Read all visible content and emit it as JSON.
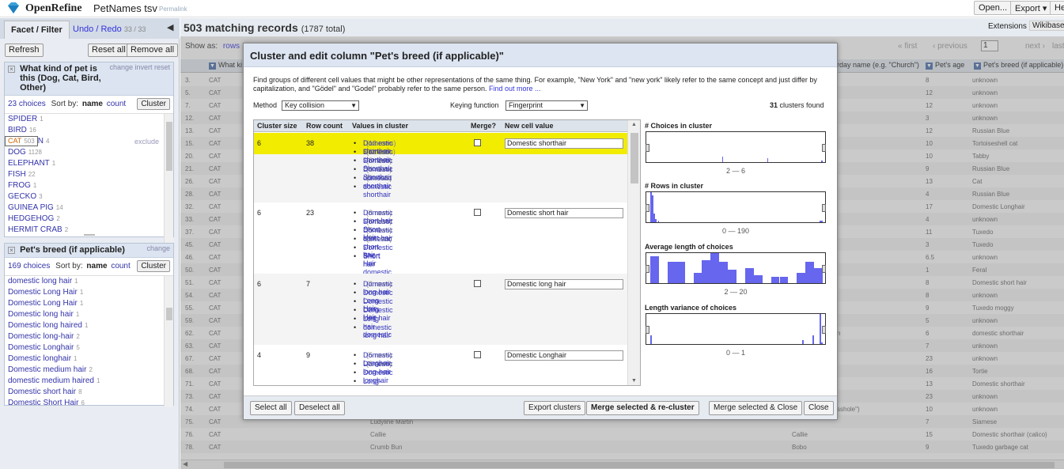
{
  "header": {
    "app_name": "OpenRefine",
    "project_name": "PetNames tsv",
    "permalink": "Permalink",
    "buttons": [
      "Open...",
      "Export ▾",
      "He"
    ]
  },
  "left_panel": {
    "tabs": {
      "facet": "Facet / Filter",
      "undo": "Undo / Redo",
      "undo_count": "33 / 33"
    },
    "refresh": "Refresh",
    "reset_all": "Reset all",
    "remove_all": "Remove all",
    "facet1": {
      "title": "What kind of pet is this (Dog, Cat, Bird, Other)",
      "controls": "change invert reset",
      "choices": "23 choices",
      "sort_by": "Sort by:",
      "sort_name": "name",
      "sort_count": "count",
      "cluster": "Cluster",
      "exclude": "exclude",
      "items": [
        {
          "label": "SPIDER",
          "count": "1"
        },
        {
          "label": "BIRD",
          "count": "16"
        },
        {
          "label": "CAT",
          "count": "503"
        },
        {
          "label": "CHICKEN",
          "count": "4"
        },
        {
          "label": "DOG",
          "count": "1128"
        },
        {
          "label": "ELEPHANT",
          "count": "1"
        },
        {
          "label": "FISH",
          "count": "22"
        },
        {
          "label": "FROG",
          "count": "1"
        },
        {
          "label": "GECKO",
          "count": "3"
        },
        {
          "label": "GUINEA PIG",
          "count": "14"
        },
        {
          "label": "HEDGEHOG",
          "count": "2"
        },
        {
          "label": "HERMIT CRAB",
          "count": "2"
        }
      ]
    },
    "facet2": {
      "title": "Pet's breed (if applicable)",
      "controls": "change",
      "choices": "169 choices",
      "sort_by": "Sort by:",
      "sort_name": "name",
      "sort_count": "count",
      "cluster": "Cluster",
      "items": [
        {
          "label": "domestic long hair",
          "count": "1"
        },
        {
          "label": "Domestic Long Hair",
          "count": "1"
        },
        {
          "label": "Domestic Long Hair",
          "count": "1"
        },
        {
          "label": "Domestic long hair",
          "count": "1"
        },
        {
          "label": "Domestic long haired",
          "count": "1"
        },
        {
          "label": "Domestic long-hair",
          "count": "2"
        },
        {
          "label": "Domestic Longhair",
          "count": "5"
        },
        {
          "label": "Domestic longhair",
          "count": "1"
        },
        {
          "label": "Domestic medium hair",
          "count": "2"
        },
        {
          "label": "domestic medium haired",
          "count": "1"
        },
        {
          "label": "Domestic short hair",
          "count": "8"
        },
        {
          "label": "Domestic Short Hair",
          "count": "6"
        }
      ]
    }
  },
  "main": {
    "title": "503 matching records",
    "total": "(1787 total)",
    "extensions": "Extensions",
    "wikibase": "Wikibase",
    "show_as": "Show as:",
    "show_rows": "rows",
    "first": "« first",
    "previous": "‹ previous",
    "page": "1",
    "next": "next ›",
    "last": "last",
    "col_what": "What ki",
    "col_day": "rday name (e.g. \"Church\")",
    "col_age": "Pet's age",
    "col_breed": "Pet's breed (if applicable)",
    "rows": [
      {
        "n": "3.",
        "t": "CAT",
        "a": "",
        "b": "",
        "d": "",
        "age": "8",
        "br": "unknown"
      },
      {
        "n": "5.",
        "t": "CAT",
        "a": "",
        "b": "",
        "d": "",
        "age": "12",
        "br": "unknown"
      },
      {
        "n": "7.",
        "t": "CAT",
        "a": "",
        "b": "",
        "d": "",
        "age": "12",
        "br": "unknown"
      },
      {
        "n": "12.",
        "t": "CAT",
        "a": "",
        "b": "",
        "d": "",
        "age": "3",
        "br": "unknown"
      },
      {
        "n": "13.",
        "t": "CAT",
        "a": "",
        "b": "",
        "d": "",
        "age": "12",
        "br": "Russian Blue"
      },
      {
        "n": "15.",
        "t": "CAT",
        "a": "",
        "b": "",
        "d": "",
        "age": "10",
        "br": "Tortoiseshell cat"
      },
      {
        "n": "20.",
        "t": "CAT",
        "a": "",
        "b": "",
        "d": "",
        "age": "10",
        "br": "Tabby"
      },
      {
        "n": "21.",
        "t": "CAT",
        "a": "",
        "b": "",
        "d": "",
        "age": "9",
        "br": "Russian Blue"
      },
      {
        "n": "26.",
        "t": "CAT",
        "a": "",
        "b": "",
        "d": "",
        "age": "13",
        "br": "Cat"
      },
      {
        "n": "28.",
        "t": "CAT",
        "a": "",
        "b": "",
        "d": "",
        "age": "4",
        "br": "Russian Blue"
      },
      {
        "n": "32.",
        "t": "CAT",
        "a": "",
        "b": "",
        "d": "",
        "age": "17",
        "br": "Domestic Longhair"
      },
      {
        "n": "33.",
        "t": "CAT",
        "a": "",
        "b": "",
        "d": "",
        "age": "4",
        "br": "unknown"
      },
      {
        "n": "37.",
        "t": "CAT",
        "a": "",
        "b": "",
        "d": "",
        "age": "11",
        "br": "Tuxedo"
      },
      {
        "n": "45.",
        "t": "CAT",
        "a": "",
        "b": "",
        "d": "",
        "age": "3",
        "br": "Tuxedo"
      },
      {
        "n": "46.",
        "t": "CAT",
        "a": "",
        "b": "",
        "d": "",
        "age": "6.5",
        "br": "unknown"
      },
      {
        "n": "50.",
        "t": "CAT",
        "a": "",
        "b": "",
        "d": "",
        "age": "1",
        "br": "Feral"
      },
      {
        "n": "51.",
        "t": "CAT",
        "a": "",
        "b": "",
        "d": "",
        "age": "8",
        "br": "Domestic short hair"
      },
      {
        "n": "54.",
        "t": "CAT",
        "a": "",
        "b": "",
        "d": "",
        "age": "8",
        "br": "unknown"
      },
      {
        "n": "55.",
        "t": "CAT",
        "a": "",
        "b": "",
        "d": "",
        "age": "9",
        "br": "Tuxedo moggy"
      },
      {
        "n": "59.",
        "t": "CAT",
        "a": "",
        "b": "",
        "d": "",
        "age": "5",
        "br": "unknown"
      },
      {
        "n": "62.",
        "t": "CAT",
        "a": "",
        "b": "",
        "d": "n",
        "age": "6",
        "br": "domestic shorthair"
      },
      {
        "n": "63.",
        "t": "CAT",
        "a": "",
        "b": "",
        "d": "",
        "age": "7",
        "br": "unknown"
      },
      {
        "n": "67.",
        "t": "CAT",
        "a": "",
        "b": "",
        "d": "",
        "age": "23",
        "br": "unknown"
      },
      {
        "n": "68.",
        "t": "CAT",
        "a": "",
        "b": "",
        "d": "",
        "age": "16",
        "br": "Tortie"
      },
      {
        "n": "71.",
        "t": "CAT",
        "a": "",
        "b": "",
        "d": "",
        "age": "13",
        "br": "Domestic shorthair"
      },
      {
        "n": "73.",
        "t": "CAT",
        "a": "",
        "b": "",
        "d": "",
        "age": "23",
        "br": "unknown"
      },
      {
        "n": "74.",
        "t": "CAT",
        "a": "",
        "b": "",
        "d": "sshole\")",
        "age": "10",
        "br": "unknown"
      },
      {
        "n": "75.",
        "t": "CAT",
        "a": "Ludyline Martin",
        "b": "",
        "d": "",
        "age": "7",
        "br": "Siamese"
      },
      {
        "n": "76.",
        "t": "CAT",
        "a": "Callie",
        "b": "Callie",
        "d": "",
        "age": "15",
        "br": "Domestic shorthair (calico)"
      },
      {
        "n": "78.",
        "t": "CAT",
        "a": "Crumb Bun",
        "b": "Bobo",
        "d": "",
        "age": "9",
        "br": "Tuxedo garbage cat"
      }
    ]
  },
  "dialog": {
    "title": "Cluster and edit column \"Pet's breed (if applicable)\"",
    "description": "Find groups of different cell values that might be other representations of the same thing. For example, \"New York\" and \"new york\" likely refer to the same concept and just differ by capitalization, and \"Gödel\" and \"Godel\" probably refer to the same person.",
    "find_out_more": "Find out more ...",
    "method_label": "Method",
    "method_value": "Key collision",
    "keying_label": "Keying function",
    "keying_value": "Fingerprint",
    "clusters_found_num": "31",
    "clusters_found_text": "clusters found",
    "headers": {
      "size": "Cluster size",
      "count": "Row count",
      "values": "Values in cluster",
      "merge": "Merge?",
      "new": "New cell value"
    },
    "clusters": [
      {
        "size": "6",
        "count": "38",
        "new_value": "Domestic shorthair",
        "highlight": true,
        "values": [
          {
            "v": "Domestic shorthair",
            "r": "(12 rows)"
          },
          {
            "v": "Domestic shorthair",
            "r": "(11 rows)"
          },
          {
            "v": "Domestic Shorthair",
            "r": "(8 rows)"
          },
          {
            "v": "Domestic Shorthair",
            "r": "(4 rows)"
          },
          {
            "v": "domestic shorthair",
            "r": "(2 rows)"
          },
          {
            "v": "domestic shorthair",
            "r": ""
          }
        ]
      },
      {
        "size": "6",
        "count": "23",
        "new_value": "Domestic short hair",
        "highlight": false,
        "values": [
          {
            "v": "Domestic short hair",
            "r": "(8 rows)"
          },
          {
            "v": "Domestic Short Hair",
            "r": "(6 rows)"
          },
          {
            "v": "Domestic short hair",
            "r": "(5 rows)"
          },
          {
            "v": "domestic short hair",
            "r": "(2 rows)"
          },
          {
            "v": "Domestic Short Hair",
            "r": ""
          },
          {
            "v": "Short hair domestic",
            "r": ""
          }
        ]
      },
      {
        "size": "6",
        "count": "7",
        "new_value": "Domestic long hair",
        "highlight": false,
        "values": [
          {
            "v": "Domestic long hair",
            "r": "(2 rows)"
          },
          {
            "v": "Domestic Long Hair",
            "r": ""
          },
          {
            "v": "Domestic Long Hair",
            "r": ""
          },
          {
            "v": "Domestic long hair",
            "r": ""
          },
          {
            "v": "Long hair domestic",
            "r": ""
          },
          {
            "v": "domestic long hair",
            "r": ""
          }
        ]
      },
      {
        "size": "4",
        "count": "9",
        "new_value": "Domestic Longhair",
        "highlight": false,
        "values": [
          {
            "v": "Domestic Longhair",
            "r": "(5 rows)"
          },
          {
            "v": "Domestic long-hair",
            "r": "(2 rows)"
          },
          {
            "v": "Domestic longhair",
            "r": ""
          },
          {
            "v": "Long-hair domestic",
            "r": ""
          }
        ]
      }
    ],
    "histograms": [
      {
        "title": "# Choices in cluster",
        "range": "2 — 6",
        "bars": [
          0,
          0,
          0,
          0,
          0,
          0,
          0,
          0,
          0,
          0,
          0,
          0,
          0,
          0,
          0,
          0,
          0,
          0,
          0,
          0,
          0,
          0,
          0,
          0,
          0,
          0,
          0,
          0,
          0,
          0,
          0,
          0,
          0,
          0,
          0,
          0,
          0,
          0,
          0,
          0,
          0,
          0,
          0,
          0,
          0,
          0,
          0,
          0,
          0,
          0,
          0,
          0,
          0,
          0,
          0.18,
          0,
          0,
          0,
          0,
          0,
          0,
          0,
          0,
          0,
          0,
          0,
          0,
          0,
          0,
          0,
          0,
          0,
          0,
          0,
          0,
          0,
          0,
          0,
          0,
          0,
          0,
          0,
          0,
          0,
          0,
          0,
          0,
          0,
          0.12,
          0,
          0,
          0,
          0,
          0,
          0,
          0,
          0,
          0,
          0,
          0,
          0,
          0,
          0,
          0,
          0,
          0,
          0,
          0,
          0,
          0,
          0,
          0,
          0,
          0,
          0,
          0,
          0,
          0,
          0,
          0,
          0,
          0,
          0,
          0,
          0,
          0,
          0,
          0,
          0,
          0.05
        ]
      },
      {
        "title": "# Rows in cluster",
        "range": "0 — 190",
        "bars": [
          1,
          0.9,
          0.3,
          0.1,
          0,
          0.05,
          0,
          0,
          0,
          0,
          0,
          0,
          0,
          0,
          0,
          0,
          0,
          0,
          0,
          0,
          0,
          0,
          0,
          0,
          0,
          0,
          0,
          0,
          0,
          0,
          0,
          0,
          0,
          0,
          0,
          0,
          0,
          0,
          0,
          0,
          0,
          0,
          0,
          0,
          0,
          0,
          0,
          0,
          0,
          0,
          0,
          0,
          0,
          0,
          0,
          0,
          0,
          0,
          0,
          0,
          0,
          0,
          0,
          0,
          0,
          0,
          0,
          0,
          0,
          0,
          0,
          0,
          0,
          0,
          0,
          0,
          0,
          0,
          0,
          0,
          0,
          0,
          0,
          0,
          0,
          0,
          0,
          0,
          0,
          0,
          0,
          0,
          0,
          0,
          0,
          0,
          0,
          0,
          0,
          0,
          0,
          0,
          0,
          0,
          0,
          0,
          0,
          0,
          0,
          0,
          0,
          0,
          0.05,
          0.05
        ]
      },
      {
        "title": "Average length of choices",
        "range": "2 — 20",
        "bars": [
          0.9,
          0,
          0.7,
          0.7,
          0,
          0.35,
          0.75,
          1,
          0.7,
          0.45,
          0,
          0.5,
          0.25,
          0,
          0.2,
          0.2,
          0,
          0.35,
          0.7,
          0.5
        ]
      },
      {
        "title": "Length variance of choices",
        "range": "0 — 1",
        "bars": [
          0.3,
          0,
          0,
          0,
          0,
          0,
          0,
          0,
          0,
          0,
          0,
          0,
          0,
          0,
          0,
          0,
          0,
          0,
          0,
          0,
          0,
          0,
          0,
          0,
          0,
          0,
          0,
          0,
          0,
          0,
          0,
          0,
          0,
          0,
          0,
          0,
          0,
          0,
          0,
          0,
          0,
          0,
          0,
          0,
          0,
          0,
          0,
          0,
          0,
          0,
          0,
          0,
          0,
          0,
          0,
          0,
          0,
          0,
          0,
          0,
          0,
          0,
          0,
          0,
          0,
          0,
          0,
          0,
          0,
          0,
          0,
          0,
          0,
          0,
          0,
          0,
          0,
          0,
          0,
          0,
          0,
          0,
          0,
          0,
          0,
          0,
          0,
          0,
          0,
          0,
          0.12,
          0,
          0,
          0,
          0,
          0,
          0.3,
          0,
          0,
          0,
          1,
          0.05
        ]
      }
    ],
    "buttons": {
      "select_all": "Select all",
      "deselect_all": "Deselect all",
      "export": "Export clusters",
      "merge_recluster": "Merge selected & re-cluster",
      "merge_close": "Merge selected & Close",
      "close": "Close"
    },
    "colors": {
      "highlight": "#f1ec00",
      "bar": "#6666ee",
      "link": "#3333bb"
    }
  }
}
